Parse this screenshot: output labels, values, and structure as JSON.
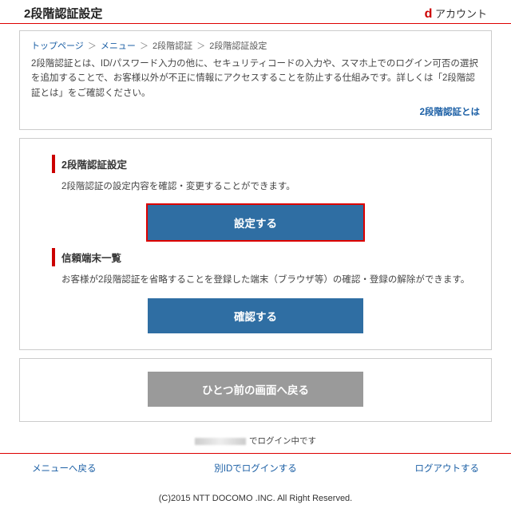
{
  "header": {
    "title": "2段階認証設定",
    "brand_prefix": "d",
    "brand_text": " アカウント"
  },
  "breadcrumb": {
    "items": [
      {
        "label": "トップページ",
        "link": true
      },
      {
        "label": "メニュー",
        "link": true
      },
      {
        "label": "2段階認証",
        "link": false
      },
      {
        "label": "2段階認証設定",
        "link": false
      }
    ],
    "sep": "＞"
  },
  "intro": {
    "text": "2段階認証とは、ID/パスワード入力の他に、セキュリティコードの入力や、スマホ上でのログイン可否の選択を追加することで、お客様以外が不正に情報にアクセスすることを防止する仕組みです。詳しくは「2段階認証とは」をご確認ください。",
    "link_label": "2段階認証とは"
  },
  "sections": {
    "settings": {
      "title": "2段階認証設定",
      "body": "2段階認証の設定内容を確認・変更することができます。",
      "button": "設定する"
    },
    "devices": {
      "title": "信頼端末一覧",
      "body": "お客様が2段階認証を省略することを登録した端末（ブラウザ等）の確認・登録の解除ができます。",
      "button": "確認する"
    }
  },
  "back_button": "ひとつ前の画面へ戻る",
  "login_status": "でログイン中です",
  "footer_links": {
    "menu": "メニューへ戻る",
    "other_id": "別IDでログインする",
    "logout": "ログアウトする"
  },
  "copyright": "(C)2015 NTT DOCOMO .INC. All Right Reserved."
}
